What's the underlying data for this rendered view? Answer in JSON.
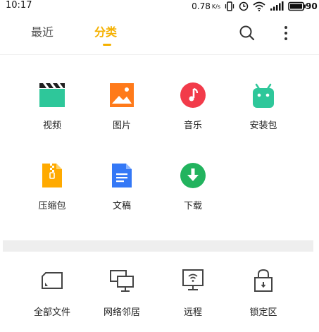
{
  "status_bar": {
    "time": "10:17",
    "net_speed": "0.78",
    "net_speed_unit": "K/s",
    "battery": "90"
  },
  "header": {
    "tabs": [
      {
        "label": "最近"
      },
      {
        "label": "分类"
      }
    ],
    "accent_color": "#f5b100"
  },
  "categories": [
    {
      "label": "视频",
      "icon": "video-clapper-icon",
      "color": "#2ec79a"
    },
    {
      "label": "图片",
      "icon": "image-icon",
      "color": "#ff7a1a"
    },
    {
      "label": "音乐",
      "icon": "music-note-icon",
      "color": "#f23b4a"
    },
    {
      "label": "安装包",
      "icon": "android-icon",
      "color": "#2ec79a"
    },
    {
      "label": "压缩包",
      "icon": "zip-file-icon",
      "color": "#ffaa00"
    },
    {
      "label": "文稿",
      "icon": "document-icon",
      "color": "#3478f6"
    },
    {
      "label": "下载",
      "icon": "download-icon",
      "color": "#22b35e"
    }
  ],
  "storage": [
    {
      "label": "全部文件",
      "icon": "sd-card-icon"
    },
    {
      "label": "网络邻居",
      "icon": "network-computers-icon"
    },
    {
      "label": "远程",
      "icon": "remote-monitor-icon"
    },
    {
      "label": "锁定区",
      "icon": "lock-icon"
    }
  ]
}
